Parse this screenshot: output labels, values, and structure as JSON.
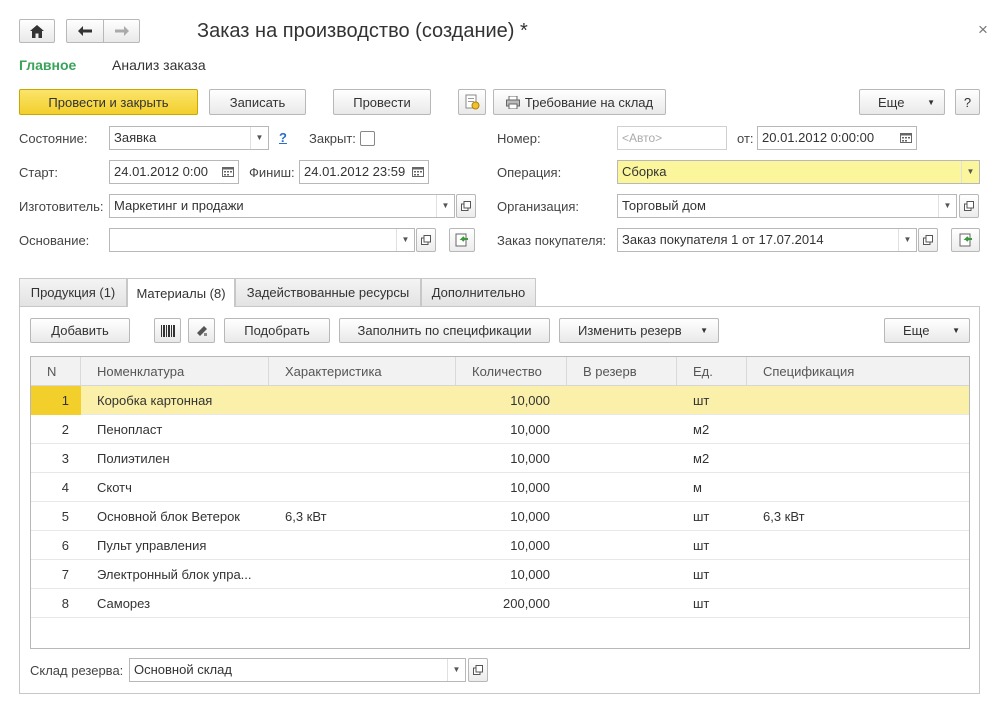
{
  "window": {
    "title": "Заказ на производство (создание) *",
    "close_glyph": "×"
  },
  "nav": {
    "home_icon": "home-icon",
    "back_icon": "arrow-left-icon",
    "forward_icon": "arrow-right-icon"
  },
  "sections": {
    "main": "Главное",
    "analysis": "Анализ заказа"
  },
  "toolbar": {
    "post_close": "Провести и закрыть",
    "save": "Записать",
    "post": "Провести",
    "requirement": "Требование на склад",
    "more": "Еще",
    "help": "?"
  },
  "form": {
    "state_label": "Состояние:",
    "state_value": "Заявка",
    "state_help": "?",
    "closed_label": "Закрыт:",
    "number_label": "Номер:",
    "number_placeholder": "<Авто>",
    "from_label": "от:",
    "from_value": "20.01.2012  0:00:00",
    "start_label": "Старт:",
    "start_value": "24.01.2012  0:00",
    "finish_label": "Финиш:",
    "finish_value": "24.01.2012 23:59",
    "operation_label": "Операция:",
    "operation_value": "Сборка",
    "manufacturer_label": "Изготовитель:",
    "manufacturer_value": "Маркетинг и продажи",
    "organization_label": "Организация:",
    "organization_value": "Торговый дом",
    "basis_label": "Основание:",
    "basis_value": "",
    "customer_order_label": "Заказ покупателя:",
    "customer_order_value": "Заказ покупателя 1 от 17.07.2014"
  },
  "tabs": [
    {
      "label": "Продукция (1)"
    },
    {
      "label": "Материалы (8)"
    },
    {
      "label": "Задействованные ресурсы"
    },
    {
      "label": "Дополнительно"
    }
  ],
  "table_toolbar": {
    "add": "Добавить",
    "select": "Подобрать",
    "fill": "Заполнить по спецификации",
    "change_reserve": "Изменить резерв",
    "more": "Еще"
  },
  "table": {
    "columns": [
      "N",
      "Номенклатура",
      "Характеристика",
      "Количество",
      "В резерв",
      "Ед.",
      "Спецификация"
    ],
    "rows": [
      {
        "n": "1",
        "name": "Коробка картонная",
        "char": "",
        "qty": "10,000",
        "reserve": "",
        "unit": "шт",
        "spec": ""
      },
      {
        "n": "2",
        "name": "Пенопласт",
        "char": "",
        "qty": "10,000",
        "reserve": "",
        "unit": "м2",
        "spec": ""
      },
      {
        "n": "3",
        "name": "Полиэтилен",
        "char": "",
        "qty": "10,000",
        "reserve": "",
        "unit": "м2",
        "spec": ""
      },
      {
        "n": "4",
        "name": "Скотч",
        "char": "",
        "qty": "10,000",
        "reserve": "",
        "unit": "м",
        "spec": ""
      },
      {
        "n": "5",
        "name": "Основной блок Ветерок",
        "char": "6,3 кВт",
        "qty": "10,000",
        "reserve": "",
        "unit": "шт",
        "spec": "6,3 кВт"
      },
      {
        "n": "6",
        "name": "Пульт управления",
        "char": "",
        "qty": "10,000",
        "reserve": "",
        "unit": "шт",
        "spec": ""
      },
      {
        "n": "7",
        "name": "Электронный блок упра...",
        "char": "",
        "qty": "10,000",
        "reserve": "",
        "unit": "шт",
        "spec": ""
      },
      {
        "n": "8",
        "name": "Саморез",
        "char": "",
        "qty": "200,000",
        "reserve": "",
        "unit": "шт",
        "spec": ""
      }
    ]
  },
  "reserve_warehouse": {
    "label": "Склад резерва:",
    "value": "Основной склад"
  },
  "colors": {
    "accent_green": "#3aa35a",
    "primary_yellow": "#f3cf2c",
    "selected_row": "#fbf0a9",
    "operation_field": "#fbf59b"
  }
}
